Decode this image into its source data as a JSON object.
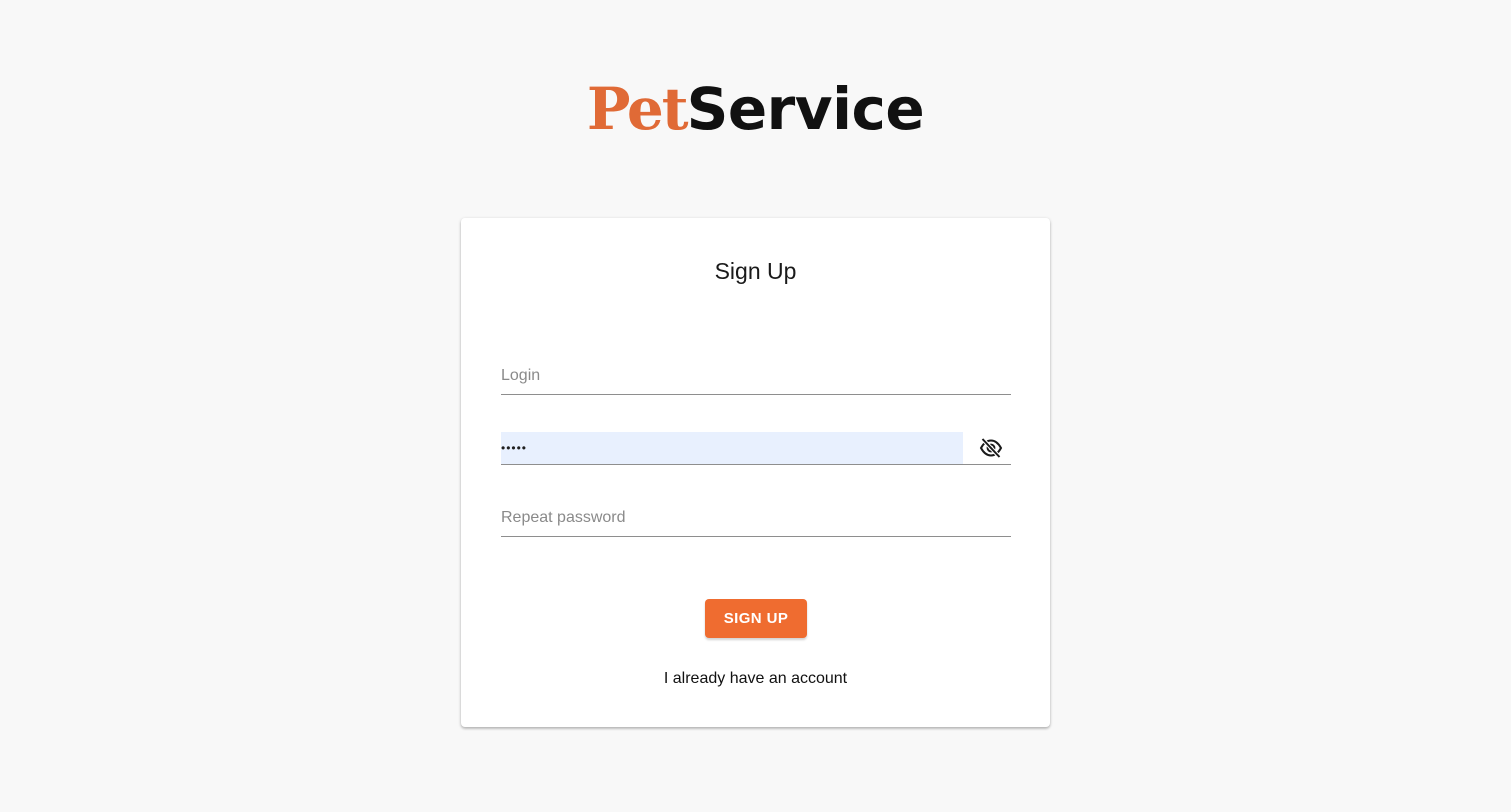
{
  "logo": {
    "part1": "Pet",
    "part2": "Service",
    "colors": {
      "part1": "#e06a36",
      "part2": "#111111"
    }
  },
  "form": {
    "title": "Sign Up",
    "login": {
      "placeholder": "Login",
      "value": ""
    },
    "password": {
      "value": "•••••",
      "toggle_icon": "eye-off-icon"
    },
    "repeat_password": {
      "placeholder": "Repeat password",
      "value": ""
    },
    "submit_label": "SIGN UP",
    "login_link": "I already have an account"
  },
  "colors": {
    "accent": "#ef6c30",
    "autofill": "#e8f0fe",
    "background": "#f8f8f8"
  }
}
